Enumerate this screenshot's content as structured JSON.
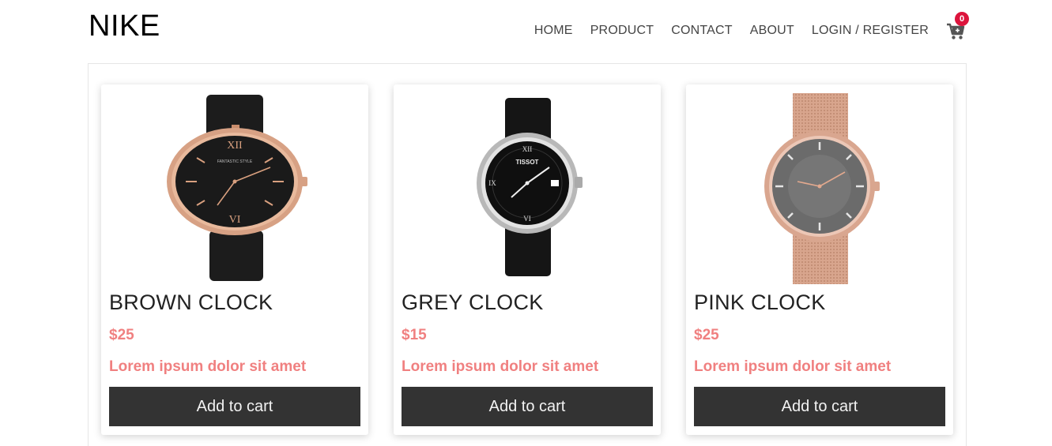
{
  "header": {
    "logo": "NIKE",
    "nav": [
      {
        "label": "HOME"
      },
      {
        "label": "PRODUCT"
      },
      {
        "label": "CONTACT"
      },
      {
        "label": "ABOUT"
      },
      {
        "label": "LOGIN / REGISTER"
      }
    ],
    "cart": {
      "icon": "cart-icon",
      "count": "0",
      "badge_color": "#dc143c"
    }
  },
  "products": [
    {
      "title": "BROWN CLOCK",
      "price": "$25",
      "description": "Lorem ipsum dolor sit amet",
      "button": "Add to cart",
      "image": "rose-gold-watch-black-strap"
    },
    {
      "title": "GREY CLOCK",
      "price": "$15",
      "description": "Lorem ipsum dolor sit amet",
      "button": "Add to cart",
      "image": "silver-watch-black-leather-strap"
    },
    {
      "title": "PINK CLOCK",
      "price": "$25",
      "description": "Lorem ipsum dolor sit amet",
      "button": "Add to cart",
      "image": "rose-gold-mesh-watch"
    }
  ],
  "colors": {
    "accent": "#f08080",
    "button_bg": "#333333"
  }
}
